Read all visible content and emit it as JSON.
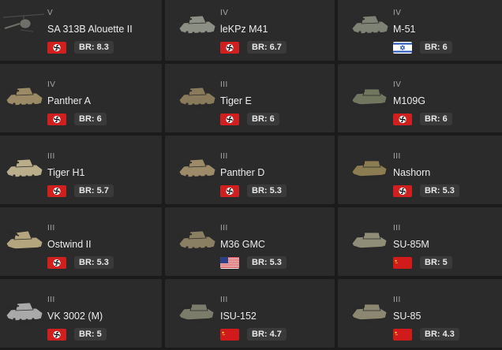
{
  "vehicles": [
    {
      "rank": "V",
      "name": "SA 313B Alouette II",
      "br": "BR: 8.3",
      "flag": "germany",
      "icon": "helicopter-icon",
      "tone": "#6f6f6a"
    },
    {
      "rank": "IV",
      "name": "leKPz M41",
      "br": "BR: 6.7",
      "flag": "germany",
      "icon": "tank-icon",
      "tone": "#8c8f84"
    },
    {
      "rank": "IV",
      "name": "M-51",
      "br": "BR: 6",
      "flag": "israel",
      "icon": "tank-icon",
      "tone": "#7e8275"
    },
    {
      "rank": "IV",
      "name": "Panther A",
      "br": "BR: 6",
      "flag": "germany",
      "icon": "tank-icon",
      "tone": "#9b8a66"
    },
    {
      "rank": "III",
      "name": "Tiger E",
      "br": "BR: 6",
      "flag": "germany",
      "icon": "tank-icon",
      "tone": "#8a7a5c"
    },
    {
      "rank": "IV",
      "name": "M109G",
      "br": "BR: 6",
      "flag": "germany",
      "icon": "spg-icon",
      "tone": "#71765f"
    },
    {
      "rank": "III",
      "name": "Tiger H1",
      "br": "BR: 5.7",
      "flag": "germany",
      "icon": "tank-icon",
      "tone": "#b9ad8a"
    },
    {
      "rank": "III",
      "name": "Panther D",
      "br": "BR: 5.3",
      "flag": "germany",
      "icon": "tank-icon",
      "tone": "#9d8a68"
    },
    {
      "rank": "III",
      "name": "Nashorn",
      "br": "BR: 5.3",
      "flag": "germany",
      "icon": "spg-icon",
      "tone": "#8c7c52"
    },
    {
      "rank": "III",
      "name": "Ostwind II",
      "br": "BR: 5.3",
      "flag": "germany",
      "icon": "spaa-icon",
      "tone": "#b3a57d"
    },
    {
      "rank": "III",
      "name": "M36 GMC",
      "br": "BR: 5.3",
      "flag": "usa",
      "icon": "tank-icon",
      "tone": "#8a7f63"
    },
    {
      "rank": "III",
      "name": "SU-85M",
      "br": "BR: 5",
      "flag": "ussr",
      "icon": "spg-icon",
      "tone": "#8f8d78"
    },
    {
      "rank": "III",
      "name": "VK 3002 (M)",
      "br": "BR: 5",
      "flag": "germany",
      "icon": "tank-icon",
      "tone": "#a9a9a9"
    },
    {
      "rank": "III",
      "name": "ISU-152",
      "br": "BR: 4.7",
      "flag": "ussr",
      "icon": "spg-icon",
      "tone": "#7b7c6a"
    },
    {
      "rank": "III",
      "name": "SU-85",
      "br": "BR: 4.3",
      "flag": "ussr",
      "icon": "spg-icon",
      "tone": "#8b8770"
    }
  ]
}
